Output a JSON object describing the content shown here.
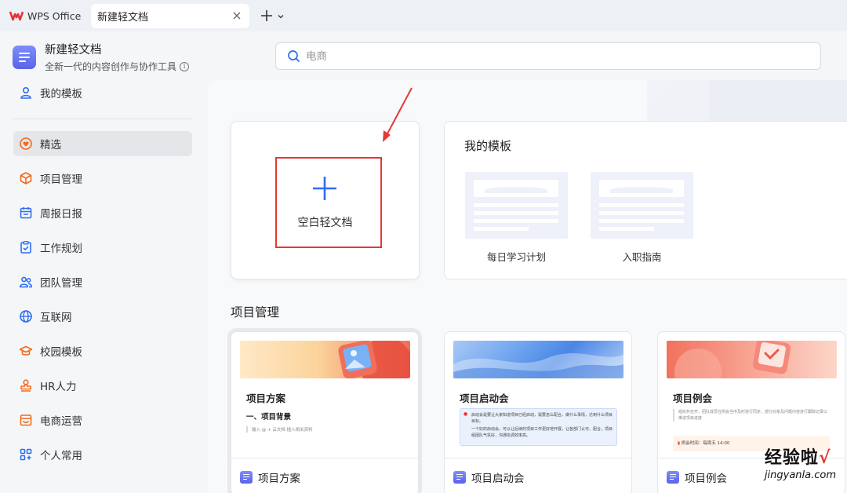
{
  "titlebar": {
    "app_name": "WPS Office",
    "doc_tab_title": "新建轻文档"
  },
  "brand": {
    "title": "新建轻文档",
    "subtitle": "全新一代的内容创作与协作工具"
  },
  "search": {
    "placeholder": "电商"
  },
  "sidebar": {
    "items": [
      {
        "label": "我的模板",
        "icon": "user-icon"
      },
      {
        "label": "精选",
        "icon": "heart-badge-icon",
        "active": true
      },
      {
        "label": "项目管理",
        "icon": "cube-icon"
      },
      {
        "label": "周报日报",
        "icon": "calendar-icon"
      },
      {
        "label": "工作规划",
        "icon": "clipboard-check-icon"
      },
      {
        "label": "团队管理",
        "icon": "team-icon"
      },
      {
        "label": "互联网",
        "icon": "globe-icon"
      },
      {
        "label": "校园模板",
        "icon": "graduation-cap-icon"
      },
      {
        "label": "HR人力",
        "icon": "stamp-icon"
      },
      {
        "label": "电商运营",
        "icon": "storefront-icon"
      },
      {
        "label": "个人常用",
        "icon": "grid-plus-icon"
      }
    ]
  },
  "blank": {
    "label": "空白轻文档"
  },
  "my_templates": {
    "title": "我的模板",
    "items": [
      {
        "name": "每日学习计划"
      },
      {
        "name": "入职指南"
      }
    ]
  },
  "project_section": {
    "title": "项目管理",
    "cards": [
      {
        "title": "项目方案",
        "heading": "一、项目背景",
        "body": "输入 @ + 云文档 插入相关资料",
        "footer": "项目方案"
      },
      {
        "title": "项目启动会",
        "body_lines": [
          "启动会是要让大家知道项目已经启动，需要怎么配合，做什么事情，达到什么项目目标。",
          "一个好的启动会，可以让后续的项目工作更好地开展，让各部门认可、配合，项目组团队气氛好，沟通协调效率高。"
        ],
        "footer": "项目启动会"
      },
      {
        "title": "项目例会",
        "body": "组织并召开，团队成员在例会当中及时进行同步，部分对象及问题内容进行跟踪记录以推进项目进度",
        "meeting_time": "例会时间：每周五 14:00",
        "footer": "项目例会"
      }
    ]
  },
  "watermark": {
    "cn_main": "经验啦",
    "cn_check": "√",
    "en": "jingyanla.com"
  },
  "colors": {
    "accent_blue": "#2c6df4",
    "highlight_red": "#e53935",
    "nav_orange": "#f06a1d",
    "doc_purple": "#5a63e8"
  }
}
